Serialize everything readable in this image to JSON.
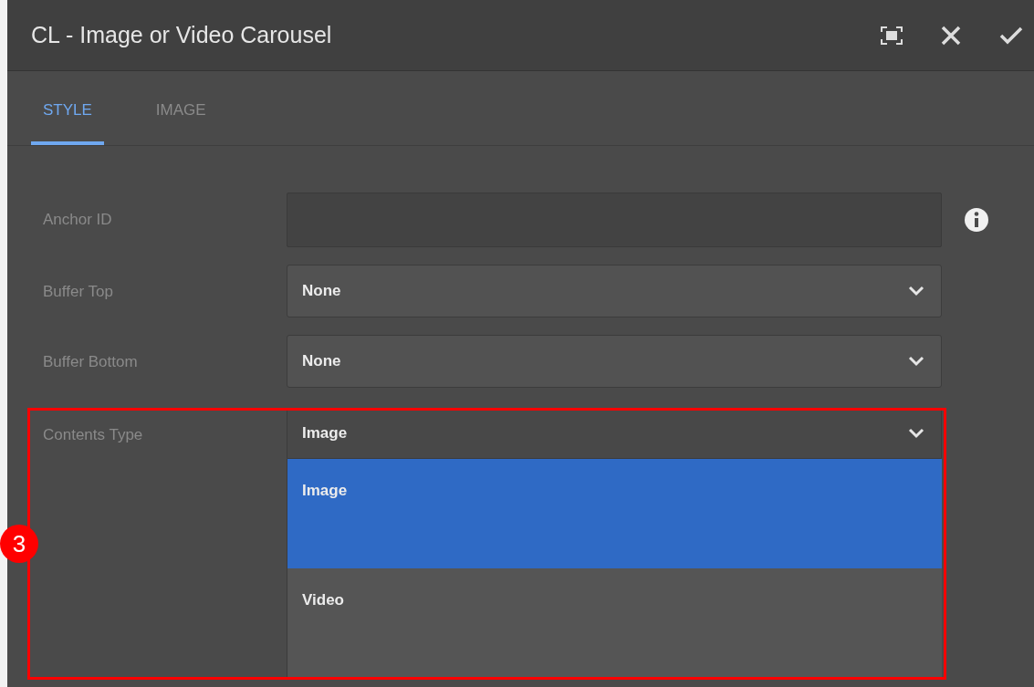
{
  "dialog": {
    "title": "CL - Image or Video Carousel",
    "actions": [
      {
        "kind": "fullscreen"
      },
      {
        "kind": "close"
      },
      {
        "kind": "done"
      }
    ]
  },
  "tabs": [
    {
      "label": "STYLE",
      "selected": true
    },
    {
      "label": "IMAGE",
      "selected": false
    }
  ],
  "fields": [
    {
      "label": "Anchor ID",
      "kind": "text",
      "info": true
    },
    {
      "label": "Buffer Top",
      "kind": "select",
      "value": "None",
      "info": false,
      "expanded": false
    },
    {
      "label": "Buffer Bottom",
      "kind": "select",
      "value": "None",
      "info": false,
      "expanded": false
    },
    {
      "label": "Contents Type",
      "kind": "select",
      "value": "Image",
      "info": false,
      "expanded": true,
      "annotation": "3",
      "options": [
        {
          "label": "Image",
          "selected": true
        },
        {
          "label": "Video",
          "selected": false
        }
      ]
    }
  ]
}
